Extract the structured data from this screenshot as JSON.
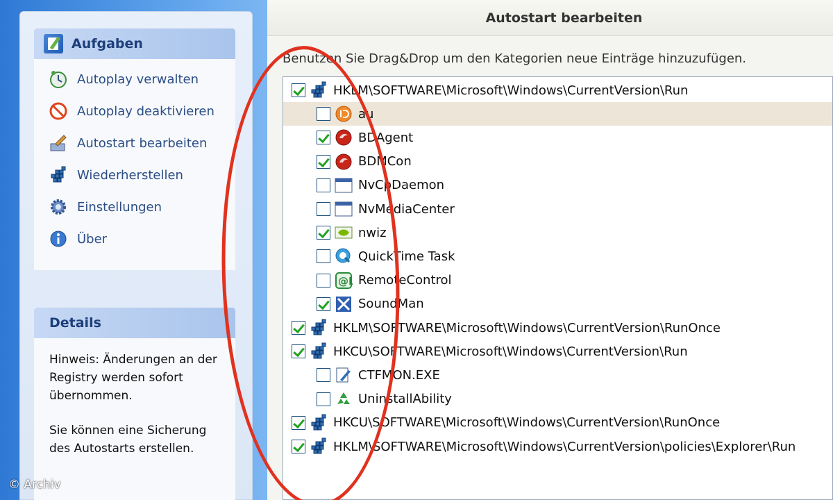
{
  "left": {
    "tasks_title": "Aufgaben",
    "tasks": [
      {
        "label": "Autoplay verwalten",
        "icon": "clock-icon"
      },
      {
        "label": "Autoplay deaktivieren",
        "icon": "no-entry-icon"
      },
      {
        "label": "Autostart bearbeiten",
        "icon": "edit-brush-icon"
      },
      {
        "label": "Wiederherstellen",
        "icon": "registry-icon"
      },
      {
        "label": "Einstellungen",
        "icon": "gear-icon"
      },
      {
        "label": "Über",
        "icon": "info-icon"
      }
    ],
    "details_title": "Details",
    "details_p1": "Hinweis: Änderungen an der Registry werden sofort übernommen.",
    "details_p2": "Sie können eine Sicherung des Autostarts erstellen."
  },
  "right": {
    "title": "Autostart bearbeiten",
    "instruction": "Benutzen Sie Drag&Drop um den Kategorien neue Einträge hinzuzufügen.",
    "tree": [
      {
        "label": "HKLM\\SOFTWARE\\Microsoft\\Windows\\CurrentVersion\\Run",
        "level": 0,
        "checked": true,
        "icon": "registry-icon"
      },
      {
        "label": "au",
        "level": 1,
        "checked": false,
        "icon": "orange-power-icon",
        "selected": true
      },
      {
        "label": "BDAgent",
        "level": 1,
        "checked": true,
        "icon": "bitdefender-icon"
      },
      {
        "label": "BDMCon",
        "level": 1,
        "checked": true,
        "icon": "bitdefender-icon"
      },
      {
        "label": "NvCpDaemon",
        "level": 1,
        "checked": false,
        "icon": "window-icon"
      },
      {
        "label": "NvMediaCenter",
        "level": 1,
        "checked": false,
        "icon": "window-icon"
      },
      {
        "label": "nwiz",
        "level": 1,
        "checked": true,
        "icon": "nvidia-icon"
      },
      {
        "label": "QuickTime Task",
        "level": 1,
        "checked": false,
        "icon": "quicktime-icon"
      },
      {
        "label": "RemoteControl",
        "level": 1,
        "checked": false,
        "icon": "remote-icon"
      },
      {
        "label": "SoundMan",
        "level": 1,
        "checked": true,
        "icon": "soundman-icon"
      },
      {
        "label": "HKLM\\SOFTWARE\\Microsoft\\Windows\\CurrentVersion\\RunOnce",
        "level": 0,
        "checked": true,
        "icon": "registry-icon"
      },
      {
        "label": "HKCU\\SOFTWARE\\Microsoft\\Windows\\CurrentVersion\\Run",
        "level": 0,
        "checked": true,
        "icon": "registry-icon"
      },
      {
        "label": "CTFMON.EXE",
        "level": 1,
        "checked": false,
        "icon": "pen-doc-icon"
      },
      {
        "label": "UninstallAbility",
        "level": 1,
        "checked": false,
        "icon": "recycle-icon"
      },
      {
        "label": "HKCU\\SOFTWARE\\Microsoft\\Windows\\CurrentVersion\\RunOnce",
        "level": 0,
        "checked": true,
        "icon": "registry-icon"
      },
      {
        "label": "HKLM\\SOFTWARE\\Microsoft\\Windows\\CurrentVersion\\policies\\Explorer\\Run",
        "level": 0,
        "checked": true,
        "icon": "registry-icon"
      }
    ]
  },
  "watermark": "© Archiv",
  "colors": {
    "annotation": "#e0321f",
    "checkmark": "#21a121",
    "task_text": "#2b4d85"
  }
}
